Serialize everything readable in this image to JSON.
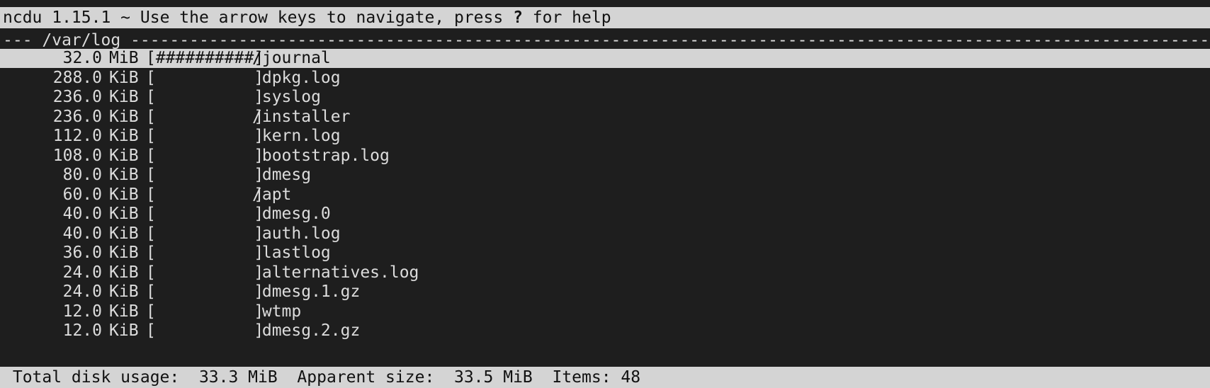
{
  "header": {
    "app": "ncdu 1.15.1",
    "hint_prefix": " ~ Use the arrow keys to navigate, press ",
    "hint_key": "?",
    "hint_suffix": " for help"
  },
  "path_bar": {
    "text": "--- /var/log -------------------------------------------------------------------------------------------------------------------------------------------------------------"
  },
  "rows": [
    {
      "size": "32.0",
      "unit": "MiB",
      "bar": "[##########]",
      "name": "/journal",
      "selected": true
    },
    {
      "size": "288.0",
      "unit": "KiB",
      "bar": "[          ]",
      "name": " dpkg.log",
      "selected": false
    },
    {
      "size": "236.0",
      "unit": "KiB",
      "bar": "[          ]",
      "name": " syslog",
      "selected": false
    },
    {
      "size": "236.0",
      "unit": "KiB",
      "bar": "[          ]",
      "name": "/installer",
      "selected": false
    },
    {
      "size": "112.0",
      "unit": "KiB",
      "bar": "[          ]",
      "name": " kern.log",
      "selected": false
    },
    {
      "size": "108.0",
      "unit": "KiB",
      "bar": "[          ]",
      "name": " bootstrap.log",
      "selected": false
    },
    {
      "size": "80.0",
      "unit": "KiB",
      "bar": "[          ]",
      "name": " dmesg",
      "selected": false
    },
    {
      "size": "60.0",
      "unit": "KiB",
      "bar": "[          ]",
      "name": "/apt",
      "selected": false
    },
    {
      "size": "40.0",
      "unit": "KiB",
      "bar": "[          ]",
      "name": " dmesg.0",
      "selected": false
    },
    {
      "size": "40.0",
      "unit": "KiB",
      "bar": "[          ]",
      "name": " auth.log",
      "selected": false
    },
    {
      "size": "36.0",
      "unit": "KiB",
      "bar": "[          ]",
      "name": " lastlog",
      "selected": false
    },
    {
      "size": "24.0",
      "unit": "KiB",
      "bar": "[          ]",
      "name": " alternatives.log",
      "selected": false
    },
    {
      "size": "24.0",
      "unit": "KiB",
      "bar": "[          ]",
      "name": " dmesg.1.gz",
      "selected": false
    },
    {
      "size": "12.0",
      "unit": "KiB",
      "bar": "[          ]",
      "name": " wtmp",
      "selected": false
    },
    {
      "size": "12.0",
      "unit": "KiB",
      "bar": "[          ]",
      "name": " dmesg.2.gz",
      "selected": false
    }
  ],
  "status": {
    "total_label": " Total disk usage:",
    "total_value": "  33.3 MiB",
    "apparent_label": "  Apparent size:",
    "apparent_value": "  33.5 MiB",
    "items_label": "  Items:",
    "items_value": " 48"
  },
  "colors": {
    "background": "#1e1e1e",
    "inverse_bar": "#d4d4d4",
    "text": "#dcdcdc"
  }
}
